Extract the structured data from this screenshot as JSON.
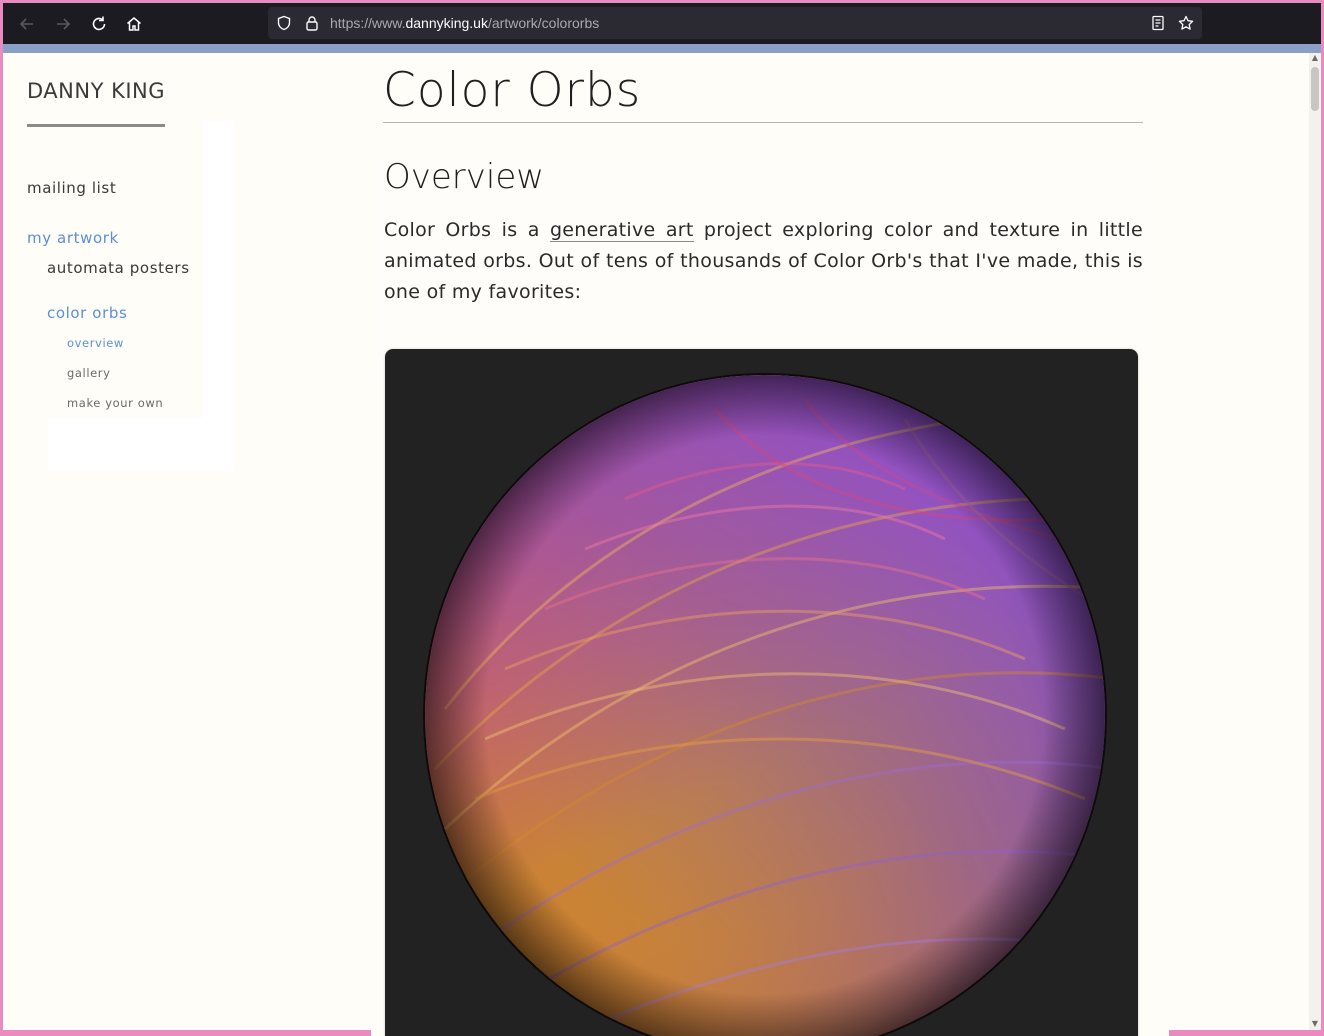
{
  "browser": {
    "url_prefix": "https://www.",
    "url_host": "dannyking.uk",
    "url_path": "/artwork/colororbs"
  },
  "sidebar": {
    "brand": "DANNY KING",
    "items": [
      {
        "label": "mailing list",
        "level": 1,
        "active": false
      },
      {
        "label": "my artwork",
        "level": 1,
        "active": true
      },
      {
        "label": "automata posters",
        "level": 2,
        "active": false
      },
      {
        "label": "color orbs",
        "level": 2,
        "active": true
      },
      {
        "label": "overview",
        "level": 3,
        "active": true
      },
      {
        "label": "gallery",
        "level": 3,
        "active": false
      },
      {
        "label": "make your own",
        "level": 3,
        "active": false
      }
    ]
  },
  "main": {
    "title": "Color Orbs",
    "section_heading": "Overview",
    "paragraph": {
      "before_link": "Color Orbs is a ",
      "link": "generative art",
      "after_link": " project exploring color and texture in little animated orbs. Out of tens of thousands of Color Orb's that I've made, this is one of my favorites:"
    }
  },
  "colors": {
    "link_active": "#5b8fd6",
    "chrome_bg": "#1c1b22",
    "page_bg": "#fffdf7",
    "orb_frame": "#222222"
  }
}
